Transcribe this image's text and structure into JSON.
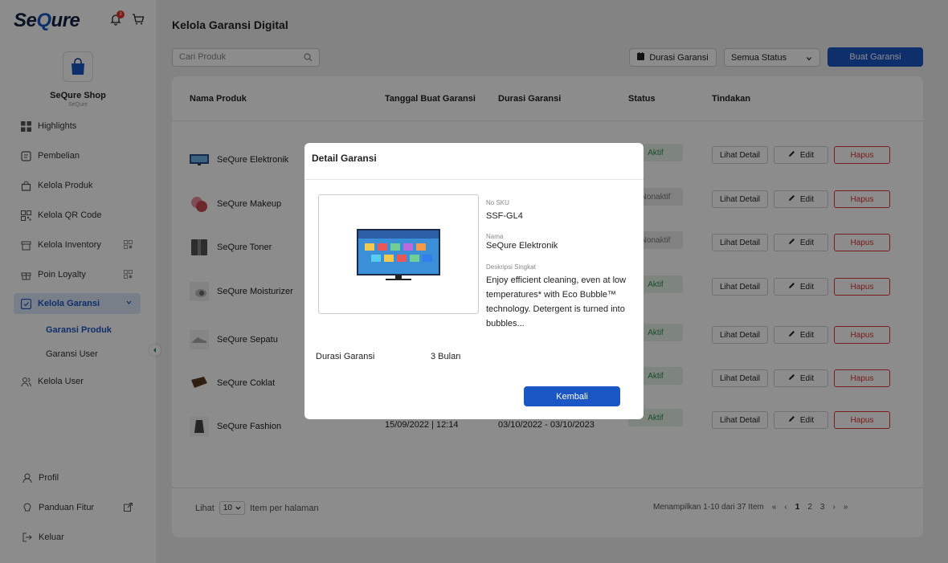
{
  "brand": {
    "logo_pre": "Se",
    "logo_q": "Q",
    "logo_post": "ure",
    "notif_count": "3"
  },
  "shop": {
    "name": "SeQure Shop",
    "sub": "SeQure"
  },
  "nav": {
    "items": [
      {
        "label": "Highlights",
        "icon": "grid-icon"
      },
      {
        "label": "Pembelian",
        "icon": "receipt-icon"
      },
      {
        "label": "Kelola Produk",
        "icon": "bag-icon"
      },
      {
        "label": "Kelola QR Code",
        "icon": "qr-icon"
      },
      {
        "label": "Kelola Inventory",
        "icon": "box-icon"
      },
      {
        "label": "Poin Loyalty",
        "icon": "gift-icon"
      },
      {
        "label": "Kelola Garansi",
        "icon": "shield-icon"
      }
    ],
    "sub": [
      "Garansi Produk",
      "Garansi User"
    ],
    "user": "Kelola User",
    "bottom": [
      "Profil",
      "Panduan Fitur",
      "Keluar"
    ]
  },
  "header": {
    "title": "Kelola Garansi Digital",
    "search_placeholder": "Cari Produk",
    "durasi_btn": "Durasi Garansi",
    "status_select": "Semua Status",
    "create_btn": "Buat Garansi"
  },
  "table": {
    "headers": [
      "Nama Produk",
      "Tanggal Buat Garansi",
      "Durasi Garansi",
      "Status",
      "Tindakan"
    ],
    "rows": [
      {
        "name": "SeQure Elektronik",
        "date": "",
        "dur": "",
        "status": "Aktif"
      },
      {
        "name": "SeQure Makeup",
        "date": "",
        "dur": "",
        "status": "Nonaktif"
      },
      {
        "name": "SeQure Toner",
        "date": "",
        "dur": "",
        "status": "Nonaktif"
      },
      {
        "name": "SeQure Moisturizer",
        "date": "",
        "dur": "",
        "status": "Aktif"
      },
      {
        "name": "SeQure Sepatu",
        "date": "",
        "dur": "",
        "status": "Aktif"
      },
      {
        "name": "SeQure Coklat",
        "date": "",
        "dur": "",
        "status": "Aktif"
      },
      {
        "name": "SeQure Fashion",
        "date": "15/09/2022 | 12:14",
        "dur": "03/10/2022 - 03/10/2023",
        "status": "Aktif"
      }
    ],
    "actions": {
      "detail": "Lihat Detail",
      "edit": "Edit",
      "delete": "Hapus"
    }
  },
  "pager": {
    "lihat": "Lihat",
    "per_page": "10",
    "suffix": "Item per halaman",
    "info": "Menampilkan 1-10 dari 37 Item",
    "pages": [
      "1",
      "2",
      "3"
    ]
  },
  "modal": {
    "title": "Detail Garansi",
    "sku_label": "No SKU",
    "sku": "SSF-GL4",
    "name_label": "Nama",
    "name": "SeQure Elektronik",
    "desc_label": "Deskripsi Singkat",
    "desc": "Enjoy efficient cleaning, even at low temperatures* with Eco Bubble™ technology. Detergent is turned into bubbles...",
    "duration_label": "Durasi Garansi",
    "duration": "3 Bulan",
    "back_btn": "Kembali"
  },
  "colors": {
    "primary": "#1a56c4",
    "danger": "#dd3333",
    "active_badge": "#2d8a47"
  }
}
